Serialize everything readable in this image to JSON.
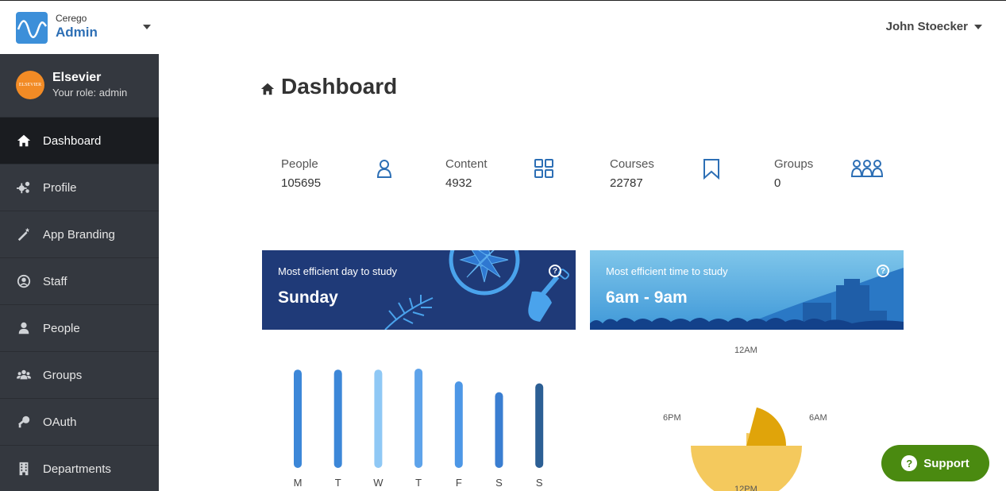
{
  "header": {
    "brand_small": "Cerego",
    "brand_big": "Admin",
    "user_name": "John Stoecker"
  },
  "sidebar": {
    "org_name": "Elsevier",
    "org_logo_text": "ELSEVIER",
    "org_role": "Your role: admin",
    "items": [
      {
        "label": "Dashboard",
        "icon": "home-icon",
        "active": true
      },
      {
        "label": "Profile",
        "icon": "gears-icon"
      },
      {
        "label": "App Branding",
        "icon": "magic-wand-icon"
      },
      {
        "label": "Staff",
        "icon": "user-circle-icon"
      },
      {
        "label": "People",
        "icon": "person-icon"
      },
      {
        "label": "Groups",
        "icon": "users-icon"
      },
      {
        "label": "OAuth",
        "icon": "key-icon"
      },
      {
        "label": "Departments",
        "icon": "building-icon"
      }
    ]
  },
  "main": {
    "title": "Dashboard",
    "stats": [
      {
        "label": "People",
        "value": "105695",
        "icon": "person-outline-icon"
      },
      {
        "label": "Content",
        "value": "4932",
        "icon": "grid-icon"
      },
      {
        "label": "Courses",
        "value": "22787",
        "icon": "bookmark-icon"
      },
      {
        "label": "Groups",
        "value": "0",
        "icon": "group-outline-icon"
      }
    ],
    "efficient_day": {
      "caption": "Most efficient day to study",
      "value": "Sunday"
    },
    "efficient_time": {
      "caption": "Most efficient time to study",
      "value": "6am - 9am"
    }
  },
  "chart_data": [
    {
      "type": "bar",
      "categories": [
        "M",
        "T",
        "W",
        "T",
        "F",
        "S",
        "S"
      ],
      "values": [
        100,
        100,
        100,
        101,
        88,
        77,
        86
      ],
      "ylim": [
        0,
        105
      ],
      "colors": [
        "#3c87d8",
        "#3c87d8",
        "#8fc8f5",
        "#5ea3ea",
        "#4d97e6",
        "#3a7ed1",
        "#2c5f94"
      ]
    },
    {
      "type": "pie",
      "labels": [
        "12AM",
        "6AM",
        "12PM",
        "6PM"
      ],
      "segments": [
        {
          "start_hour": 0,
          "end_hour": 0.5,
          "radius": 0.16,
          "color": "#f4c95d"
        },
        {
          "start_hour": 0.5,
          "end_hour": 3,
          "radius": 0.5,
          "color": "#e0a40a"
        },
        {
          "start_hour": 3,
          "end_hour": 9,
          "radius": 0.7,
          "color": "#f4c95d"
        }
      ]
    }
  ],
  "support": {
    "label": "Support"
  }
}
